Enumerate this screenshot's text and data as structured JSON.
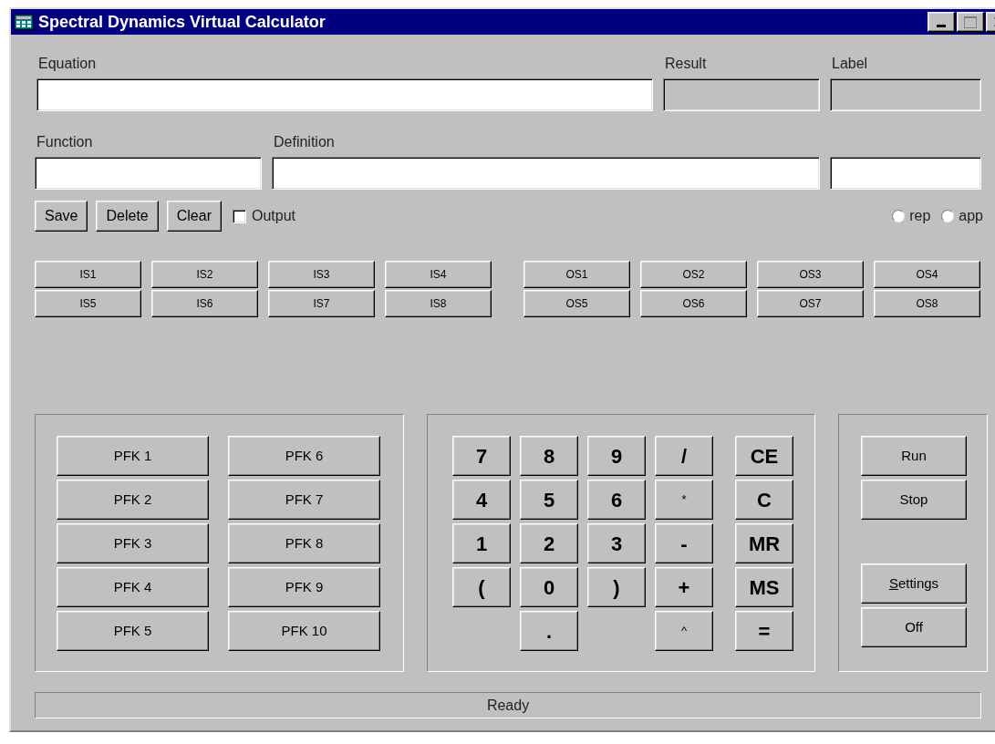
{
  "window": {
    "title": "Spectral Dynamics Virtual Calculator"
  },
  "equation_row": [
    {
      "label": "Equation",
      "kind": "input"
    },
    {
      "label": "Result",
      "kind": "readonly"
    },
    {
      "label": "Label",
      "kind": "readonly"
    }
  ],
  "function_row": [
    {
      "label": "Function",
      "kind": "input"
    },
    {
      "label": "Definition",
      "kind": "input"
    },
    {
      "kind": "input"
    }
  ],
  "action_buttons": [
    "Save",
    "Delete",
    "Clear"
  ],
  "output_checkbox": {
    "label": "Output",
    "checked": false
  },
  "radios": [
    {
      "label": "rep",
      "selected": false
    },
    {
      "label": "app",
      "selected": false
    }
  ],
  "input_slots": [
    [
      "IS1",
      "IS2",
      "IS3",
      "IS4"
    ],
    [
      "IS5",
      "IS6",
      "IS7",
      "IS8"
    ]
  ],
  "output_slots": [
    [
      "OS1",
      "OS2",
      "OS3",
      "OS4"
    ],
    [
      "OS5",
      "OS6",
      "OS7",
      "OS8"
    ]
  ],
  "pfk_columns": [
    [
      "PFK 1",
      "PFK 2",
      "PFK 3",
      "PFK 4",
      "PFK 5"
    ],
    [
      "PFK 6",
      "PFK 7",
      "PFK 8",
      "PFK 9",
      "PFK 10"
    ]
  ],
  "keypad": [
    [
      {
        "label": "7",
        "kind": "large"
      },
      {
        "label": "8",
        "kind": "large"
      },
      {
        "label": "9",
        "kind": "large"
      },
      {
        "label": "/",
        "kind": "large"
      },
      {
        "label": "CE",
        "kind": "large"
      }
    ],
    [
      {
        "label": "4",
        "kind": "large"
      },
      {
        "label": "5",
        "kind": "large"
      },
      {
        "label": "6",
        "kind": "large"
      },
      {
        "label": "*",
        "kind": "small"
      },
      {
        "label": "C",
        "kind": "large"
      }
    ],
    [
      {
        "label": "1",
        "kind": "large"
      },
      {
        "label": "2",
        "kind": "large"
      },
      {
        "label": "3",
        "kind": "large"
      },
      {
        "label": "-",
        "kind": "large"
      },
      {
        "label": "MR",
        "kind": "large"
      }
    ],
    [
      {
        "label": "(",
        "kind": "large"
      },
      {
        "label": "0",
        "kind": "large"
      },
      {
        "label": ")",
        "kind": "large"
      },
      {
        "label": "+",
        "kind": "large"
      },
      {
        "label": "MS",
        "kind": "large"
      }
    ],
    [
      {
        "kind": "blank"
      },
      {
        "label": ".",
        "kind": "large"
      },
      {
        "kind": "blank"
      },
      {
        "label": "^",
        "kind": "small"
      },
      {
        "label": "=",
        "kind": "large"
      }
    ]
  ],
  "control_buttons": [
    [
      {
        "label": "Run",
        "mnemonic": false
      },
      {
        "label": "Stop",
        "mnemonic": false
      }
    ],
    [
      {
        "label": "Settings",
        "mnemonic": true
      },
      {
        "label": "Off",
        "mnemonic": false
      }
    ]
  ],
  "status_bar": "Ready"
}
